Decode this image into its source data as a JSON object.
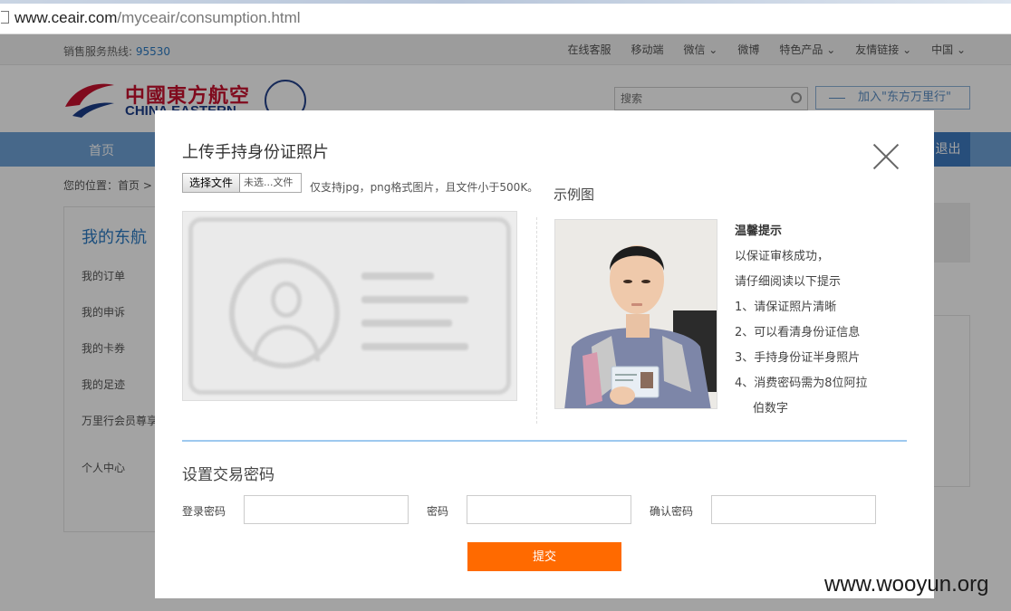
{
  "browser": {
    "url_host": "www.ceair.com",
    "url_path": "/myceair/consumption.html"
  },
  "site": {
    "hotline_label": "销售服务热线:",
    "hotline_number": "95530",
    "top_links": [
      "在线客服",
      "移动端",
      "微信 ⌄",
      "微博",
      "特色产品 ⌄",
      "友情链接 ⌄",
      "中国 ⌄"
    ],
    "logo_cn": "中國東方航空",
    "logo_en": "CHINA EASTERN",
    "search_placeholder": "搜索",
    "join_label": "加入\"东方万里行\"",
    "nav_home": "首页",
    "nav_logout": "退出",
    "breadcrumb": "您的位置：首页 > 我",
    "sidebar_title": "我的东航",
    "sidebar_items": [
      "我的订单",
      "我的申诉",
      "我的卡券",
      "我的足迹",
      "万里行会员尊享",
      "个人中心"
    ]
  },
  "modal": {
    "title": "上传手持身份证照片",
    "file_button": "选择文件",
    "file_status": "未选...文件",
    "file_hint": "仅支持jpg，png格式图片，且文件小于500K。",
    "example_label": "示例图",
    "tips_title": "温馨提示",
    "tips": [
      "以保证审核成功，",
      "请仔细阅读以下提示",
      "1、请保证照片清晰",
      "2、可以看清身份证信息",
      "3、手持身份证半身照片",
      "4、消费密码需为8位阿拉"
    ],
    "tips_cont": "伯数字",
    "section2_title": "设置交易密码",
    "login_pw_label": "登录密码",
    "pw_label": "密码",
    "confirm_pw_label": "确认密码",
    "submit_label": "提交"
  },
  "watermark": "www.wooyun.org",
  "colors": {
    "nav_blue": "#6fa3d8",
    "submit_orange": "#ff6a00",
    "brand_red": "#c8102e",
    "brand_navy": "#1b3d8a"
  }
}
